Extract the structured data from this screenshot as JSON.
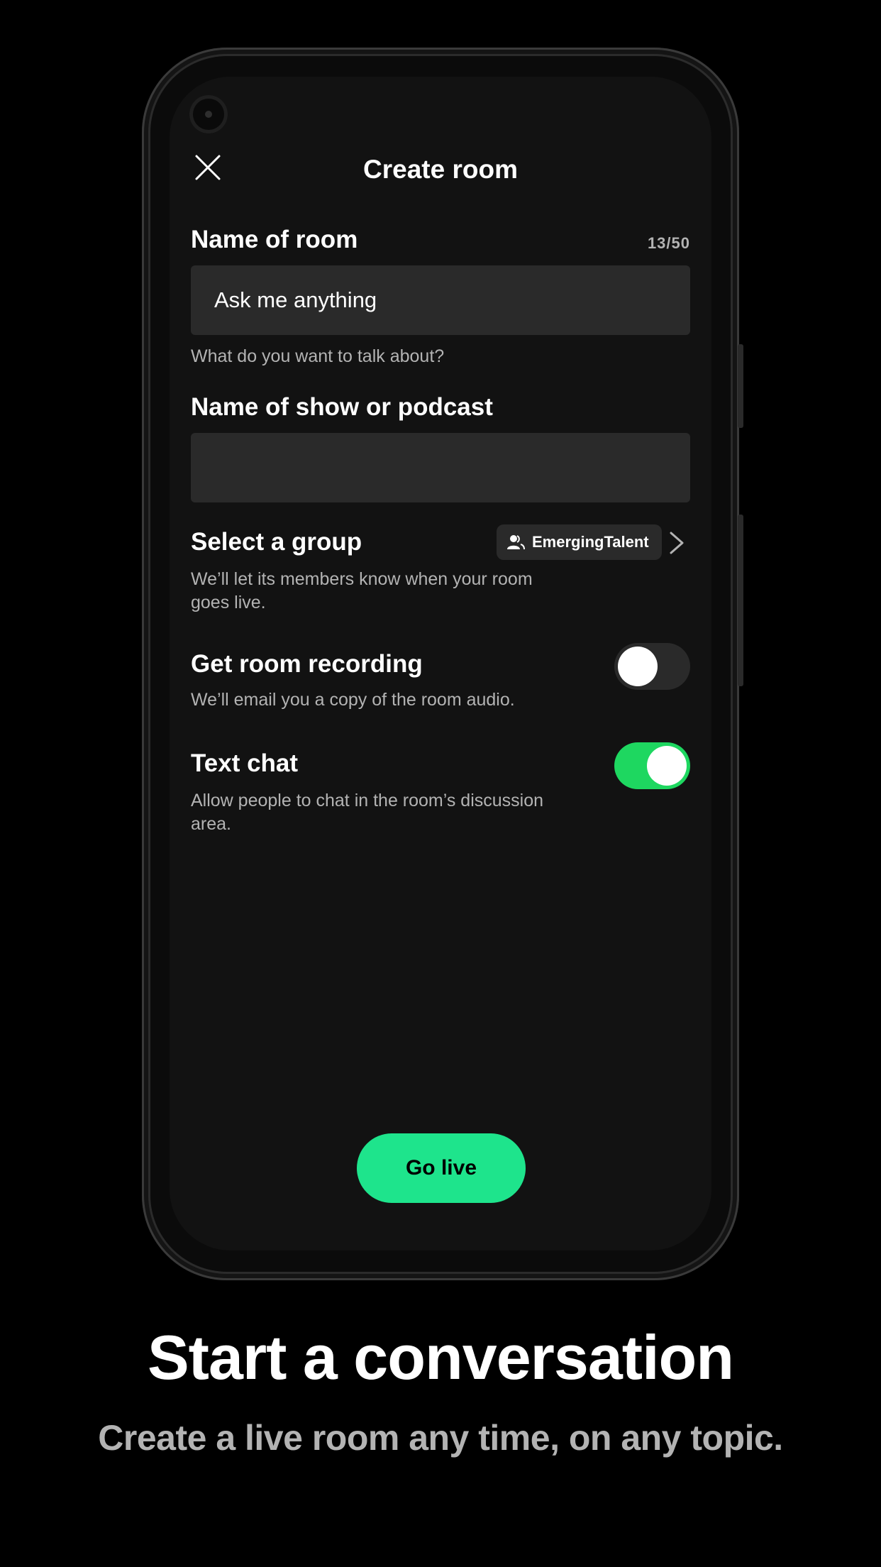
{
  "screen": {
    "title": "Create room",
    "room_name": {
      "label": "Name of room",
      "counter": "13/50",
      "value": "Ask me anything",
      "hint": "What do you want to talk about?"
    },
    "show_name": {
      "label": "Name of show or podcast",
      "value": ""
    },
    "group": {
      "label": "Select a group",
      "hint": "We’ll let its members know when your room goes live.",
      "selected": "EmergingTalent"
    },
    "recording": {
      "label": "Get room recording",
      "hint": "We’ll email you a copy of the room audio.",
      "enabled": false
    },
    "text_chat": {
      "label": "Text chat",
      "hint": "Allow people to chat in the room’s discussion area.",
      "enabled": true
    },
    "go_live_label": "Go live"
  },
  "marketing": {
    "headline": "Start a conversation",
    "subline": "Create a live room any time, on any topic."
  },
  "colors": {
    "background": "#000000",
    "screen": "#121212",
    "field": "#2a2a2a",
    "toggle_on": "#1ed760",
    "go_live": "#1ee48c",
    "muted_text": "#b3b3b3"
  },
  "icons": [
    "close-icon",
    "group-icon",
    "chevron-right-icon"
  ]
}
